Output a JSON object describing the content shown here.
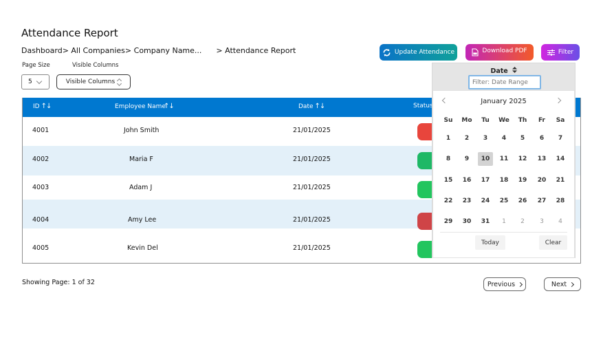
{
  "page": {
    "title": "Attendance Report",
    "breadcrumb": [
      "Dashboard",
      " > All Companies",
      " > Company Name...",
      "> Attendance Report"
    ]
  },
  "controls": {
    "page_size_label": "Page Size",
    "page_size_value": "5",
    "visible_columns_label": "Visible Columns",
    "visible_columns_button": "Visible Columns"
  },
  "actions": {
    "update_attendance": {
      "label": "Update Attendance",
      "icon": "refresh-icon"
    },
    "download_pdf": {
      "label": "Download PDF",
      "icon": "pdf-file-icon"
    },
    "filter": {
      "label": "Filter",
      "icon": "sliders-icon"
    }
  },
  "table": {
    "columns": [
      {
        "label": "ID",
        "sort": "↑↓"
      },
      {
        "label": "Employee Name",
        "sort": "↑↓"
      },
      {
        "label": "Date",
        "sort": "↑↓"
      },
      {
        "label": "Status"
      }
    ],
    "rows": [
      {
        "id": "4001",
        "name": "John Smith",
        "date": "21/01/2025",
        "status_color": "#e8453c"
      },
      {
        "id": "4002",
        "name": "Maria F",
        "date": "21/01/2025",
        "status_color": "#1eb866"
      },
      {
        "id": "4003",
        "name": "Adam J",
        "date": "21/01/2025",
        "status_color": "#22c55e"
      },
      {
        "id": "4004",
        "name": "Amy Lee",
        "date": "21/01/2025",
        "status_color": "#cf4447"
      },
      {
        "id": "4005",
        "name": "Kevin Del",
        "date": "21/01/2025",
        "status_color": "#22c55e"
      }
    ]
  },
  "pagination": {
    "showing": "Showing Page: 1 of 32",
    "previous": "Previous",
    "next": "Next"
  },
  "date_filter": {
    "title": "Date",
    "sort_icon": "▲▼",
    "input_value": "",
    "input_placeholder": "Filter: Date Range",
    "calendar": {
      "month_label": "January 2025",
      "weekdays": [
        "Su",
        "Mo",
        "Tu",
        "We",
        "Th",
        "Fr",
        "Sa"
      ],
      "weeks": [
        [
          "1",
          "2",
          "3",
          "4",
          "5",
          "6",
          "7"
        ],
        [
          "8",
          "9",
          "10",
          "11",
          "12",
          "13",
          "14"
        ],
        [
          "15",
          "16",
          "17",
          "18",
          "19",
          "20",
          "21"
        ],
        [
          "22",
          "23",
          "24",
          "25",
          "26",
          "27",
          "28"
        ],
        [
          "29",
          "30",
          "31",
          "1",
          "2",
          "3",
          "4"
        ]
      ],
      "highlighted_day": "10",
      "today_label": "Today",
      "clear_label": "Clear"
    }
  }
}
